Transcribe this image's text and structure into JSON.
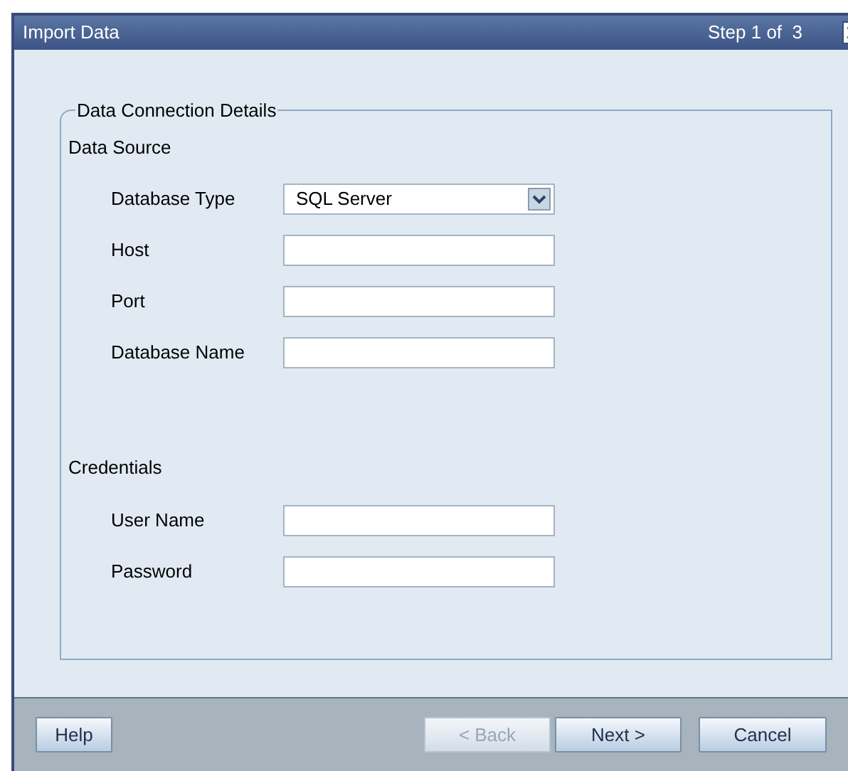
{
  "window": {
    "title": "Import Data",
    "step": "Step 1 of  3"
  },
  "group": {
    "title": "Data Connection Details",
    "sections": [
      {
        "title": "Data Source",
        "fields": [
          {
            "kind": "select",
            "label": "Database Type",
            "value": "SQL Server"
          },
          {
            "kind": "text",
            "label": "Host"
          },
          {
            "kind": "text",
            "label": "Port"
          },
          {
            "kind": "text",
            "label": "Database Name"
          }
        ]
      },
      {
        "title": "Credentials",
        "fields": [
          {
            "kind": "text",
            "label": "User Name"
          },
          {
            "kind": "password",
            "label": "Password"
          }
        ]
      }
    ]
  },
  "footer": {
    "left": [
      {
        "label": "Help",
        "disabled": false
      }
    ],
    "right": [
      {
        "label": "< Back",
        "disabled": true
      },
      {
        "label": "Next >",
        "disabled": false
      },
      {
        "label": "Cancel",
        "disabled": false
      }
    ]
  }
}
